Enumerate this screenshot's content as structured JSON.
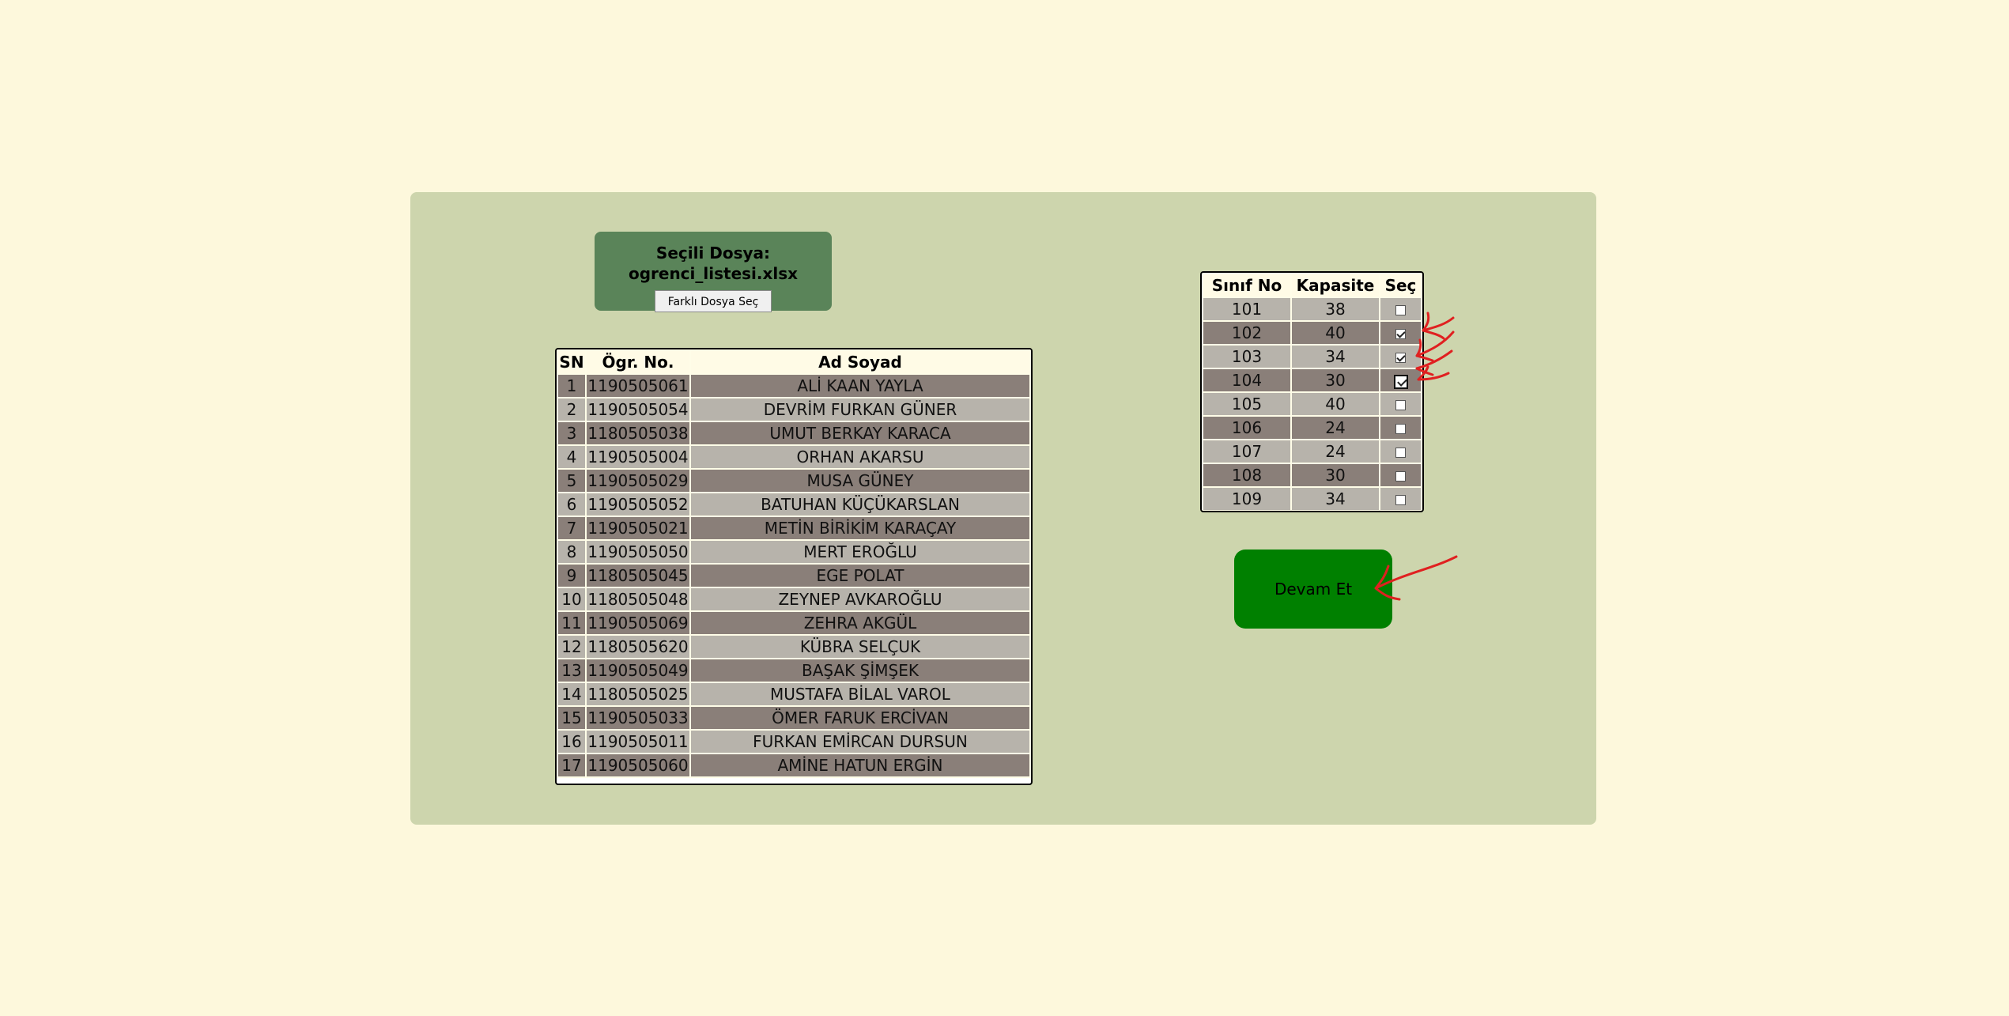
{
  "file_box": {
    "label": "Seçili Dosya: ogrenci_listesi.xlsx",
    "button_label": "Farklı Dosya Seç"
  },
  "students": {
    "headers": [
      "SN",
      "Ögr. No.",
      "Ad Soyad"
    ],
    "rows": [
      [
        "1",
        "1190505061",
        "ALİ KAAN YAYLA"
      ],
      [
        "2",
        "1190505054",
        "DEVRİM FURKAN GÜNER"
      ],
      [
        "3",
        "1180505038",
        "UMUT BERKAY KARACA"
      ],
      [
        "4",
        "1190505004",
        "ORHAN AKARSU"
      ],
      [
        "5",
        "1190505029",
        "MUSA GÜNEY"
      ],
      [
        "6",
        "1190505052",
        "BATUHAN KÜÇÜKARSLAN"
      ],
      [
        "7",
        "1190505021",
        "METİN BİRİKİM KARAÇAY"
      ],
      [
        "8",
        "1190505050",
        "MERT EROĞLU"
      ],
      [
        "9",
        "1180505045",
        "EGE POLAT"
      ],
      [
        "10",
        "1180505048",
        "ZEYNEP AVKAROĞLU"
      ],
      [
        "11",
        "1190505069",
        "ZEHRA AKGÜL"
      ],
      [
        "12",
        "1180505620",
        "KÜBRA SELÇUK"
      ],
      [
        "13",
        "1190505049",
        "BAŞAK ŞİMŞEK"
      ],
      [
        "14",
        "1180505025",
        "MUSTAFA BİLAL VAROL"
      ],
      [
        "15",
        "1190505033",
        "ÖMER FARUK ERCİVAN"
      ],
      [
        "16",
        "1190505011",
        "FURKAN EMİRCAN DURSUN"
      ],
      [
        "17",
        "1190505060",
        "AMİNE HATUN ERGİN"
      ]
    ]
  },
  "rooms": {
    "headers": [
      "Sınıf No",
      "Kapasite",
      "Seç"
    ],
    "rows": [
      {
        "no": "101",
        "capacity": "38",
        "checked": false
      },
      {
        "no": "102",
        "capacity": "40",
        "checked": true
      },
      {
        "no": "103",
        "capacity": "34",
        "checked": true
      },
      {
        "no": "104",
        "capacity": "30",
        "checked": true,
        "focused": true
      },
      {
        "no": "105",
        "capacity": "40",
        "checked": false
      },
      {
        "no": "106",
        "capacity": "24",
        "checked": false
      },
      {
        "no": "107",
        "capacity": "24",
        "checked": false
      },
      {
        "no": "108",
        "capacity": "30",
        "checked": false
      },
      {
        "no": "109",
        "capacity": "34",
        "checked": false
      }
    ]
  },
  "continue_label": "Devam Et",
  "colors": {
    "page_bg": "#fdf8dc",
    "panel_bg": "#cdd5ad",
    "file_box_bg": "#5a8459",
    "row_dark": "#8a7f79",
    "row_light": "#b7b3ab",
    "continue_bg": "#008000",
    "annotation": "#e02020"
  }
}
